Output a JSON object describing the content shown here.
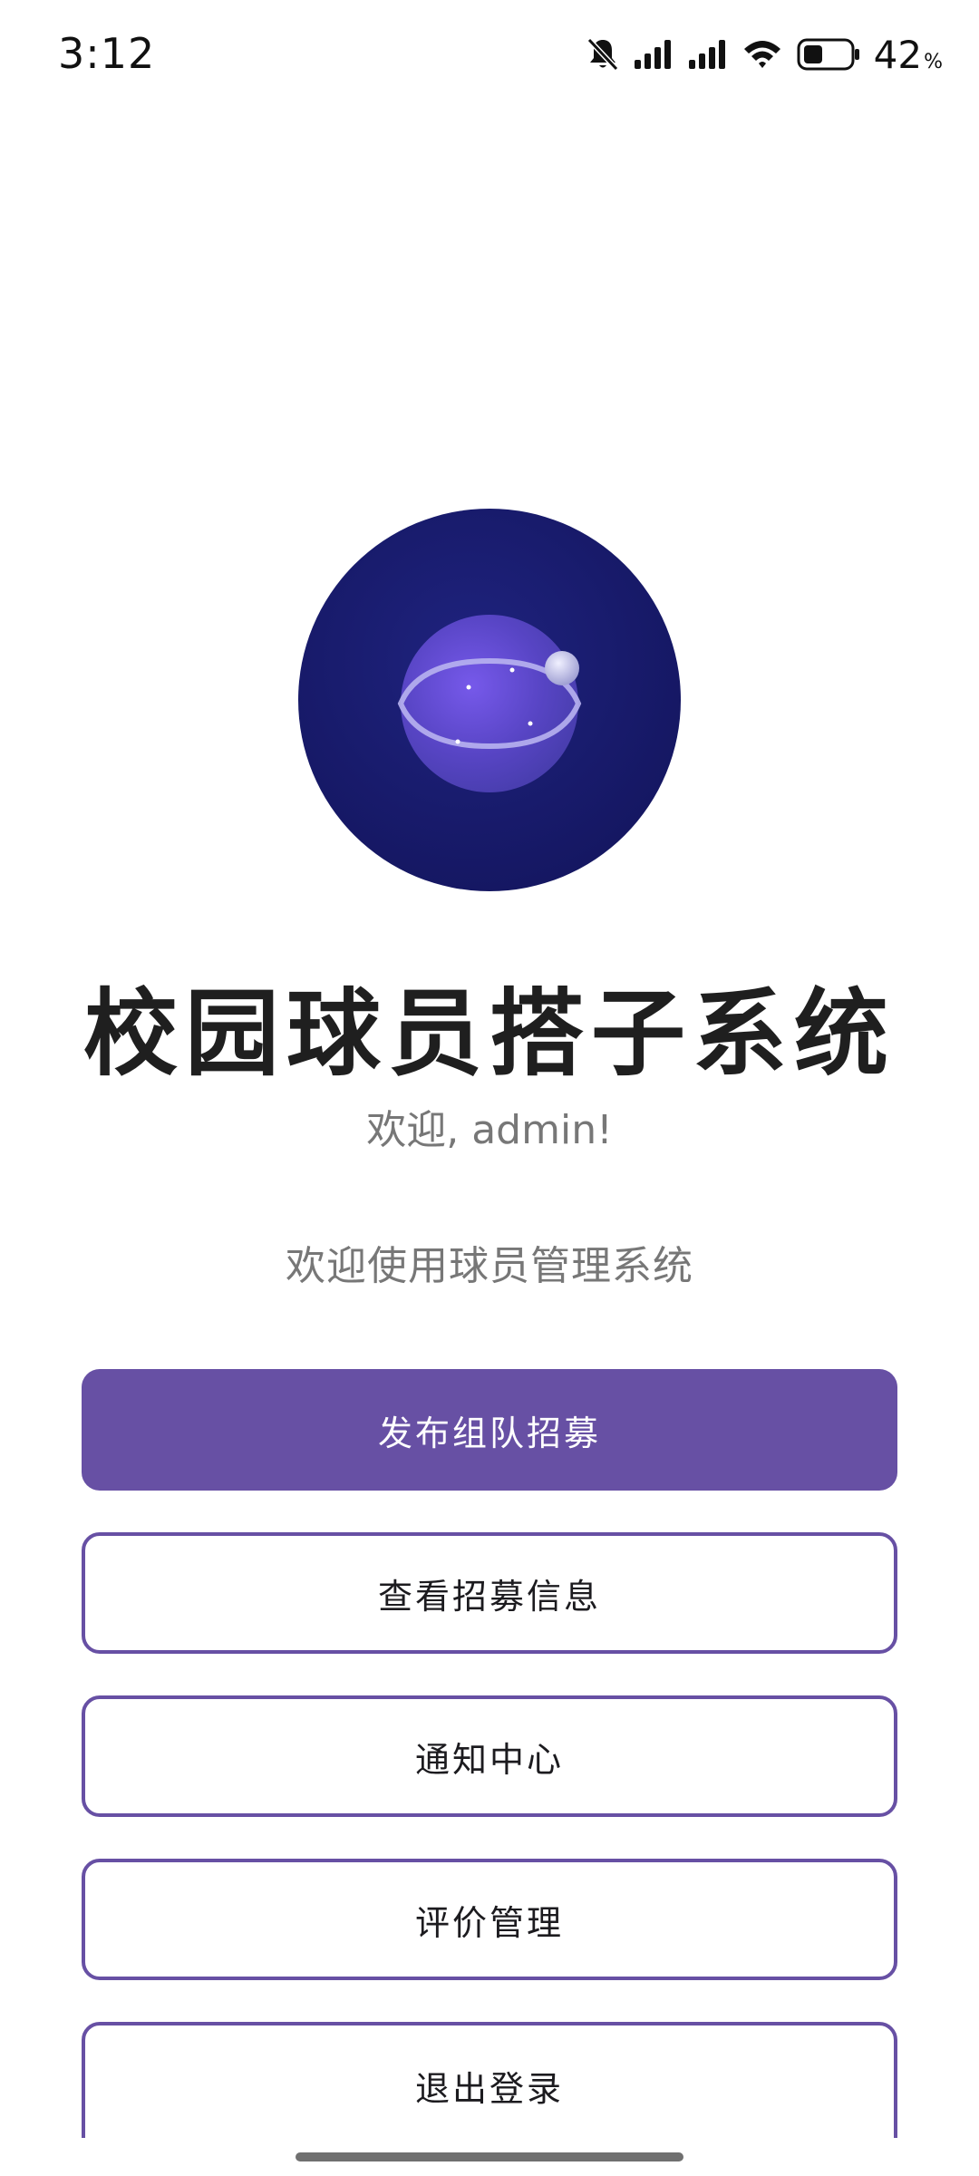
{
  "status_bar": {
    "time": "3:12",
    "battery_percent": "42",
    "battery_suffix": "%",
    "battery_level": 0.42,
    "icons": [
      "bell-off-icon",
      "signal-icon",
      "signal-icon",
      "wifi-icon",
      "battery-icon"
    ]
  },
  "logo": {
    "icon": "planet-logo-icon"
  },
  "header": {
    "title": "校园球员搭子系统",
    "welcome_user": "欢迎, admin!",
    "welcome_system": "欢迎使用球员管理系统"
  },
  "menu": {
    "buttons": [
      {
        "label": "发布组队招募",
        "style": "primary"
      },
      {
        "label": "查看招募信息",
        "style": "outline"
      },
      {
        "label": "通知中心",
        "style": "outline"
      },
      {
        "label": "评价管理",
        "style": "outline"
      },
      {
        "label": "退出登录",
        "style": "outline"
      }
    ]
  },
  "colors": {
    "primary": "#6750A4",
    "logo_background": "#1A1A6E",
    "secondary_text": "#777777"
  }
}
